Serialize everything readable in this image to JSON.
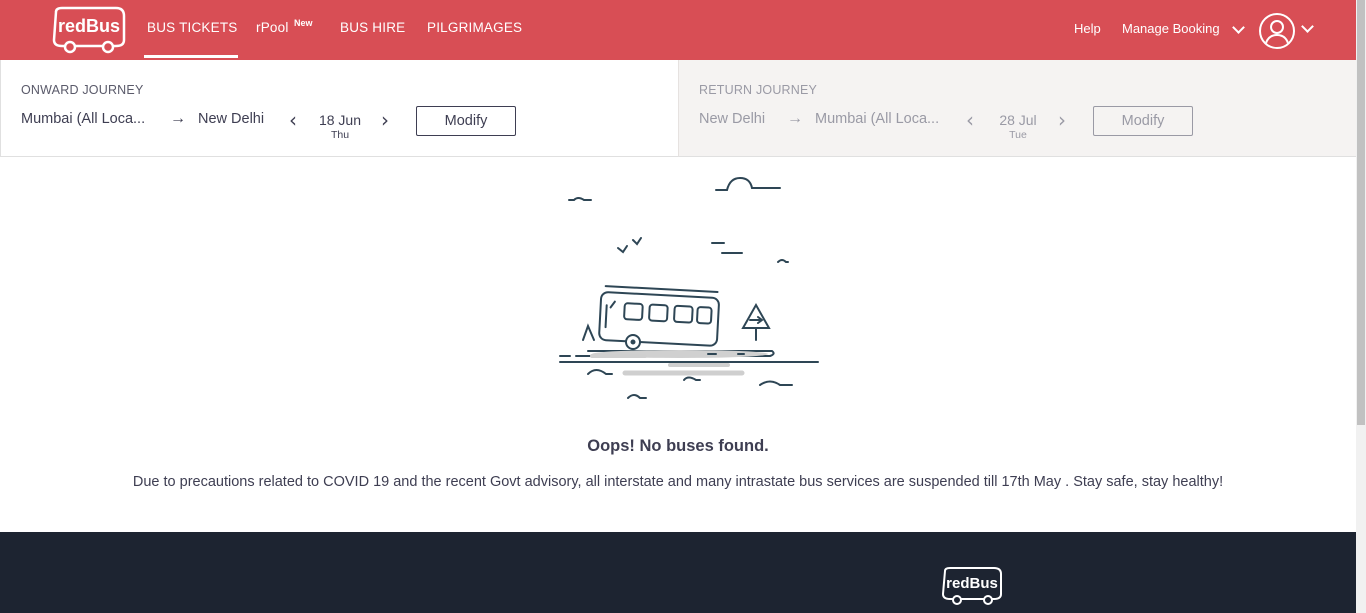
{
  "header": {
    "logo_text": "redBus",
    "nav": [
      "BUS TICKETS",
      "rPool",
      "BUS HIRE",
      "PILGRIMAGES"
    ],
    "rpool_badge": "New",
    "help": "Help",
    "manage_booking": "Manage Booking"
  },
  "onward": {
    "title": "ONWARD JOURNEY",
    "from": "Mumbai (All Loca...",
    "to": "New Delhi",
    "date": "18 Jun",
    "day": "Thu",
    "modify": "Modify"
  },
  "return": {
    "title": "RETURN JOURNEY",
    "from": "New Delhi",
    "to": "Mumbai (All Loca...",
    "date": "28 Jul",
    "day": "Tue",
    "modify": "Modify"
  },
  "empty_state": {
    "title": "Oops! No buses found.",
    "message": "Due to precautions related to COVID 19 and the recent Govt advisory, all interstate and many intrastate bus services are suspended till 17th May . Stay safe, stay healthy!"
  },
  "footer": {
    "logo_text": "redBus"
  },
  "colors": {
    "brand": "#d84e55",
    "footer": "#1d2431",
    "text": "#3e3e52"
  }
}
